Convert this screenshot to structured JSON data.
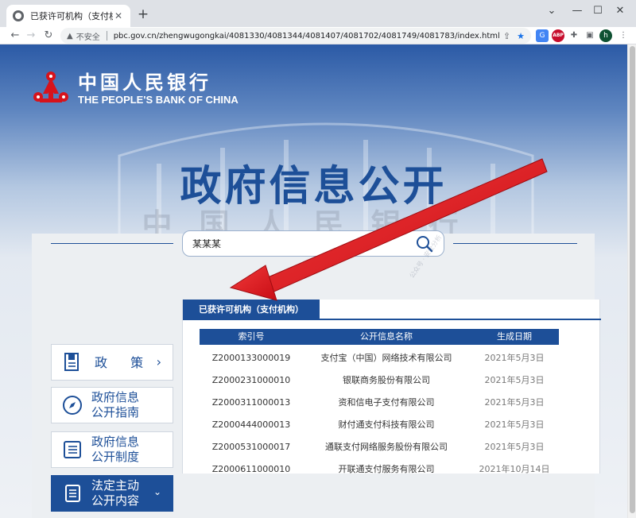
{
  "browser": {
    "tab_title": "已获许可机构（支付机构）",
    "tab_close": "✕",
    "new_tab": "+",
    "window_controls": [
      "⌄",
      "—",
      "☐",
      "✕"
    ],
    "security_label": "不安全",
    "url": "pbc.gov.cn/zhengwugongkai/4081330/4081344/4081407/4081702/4081749/4081783/index.html",
    "avatar_letter": "h",
    "abp_label": "ABP"
  },
  "header": {
    "logo_cn": "中国人民银行",
    "logo_en": "THE PEOPLE'S BANK OF CHINA",
    "hero_title": "政府信息公开",
    "building_inscription": "中国人民银行"
  },
  "search": {
    "value": "某某某"
  },
  "watermark": {
    "line1": "公众号 · ",
    "line2": "安全分析"
  },
  "sidebar": {
    "items": [
      {
        "label": "政 策",
        "chevron": "›"
      },
      {
        "label": "政府信息\n公开指南"
      },
      {
        "label": "政府信息\n公开制度"
      },
      {
        "label": "法定主动\n公开内容",
        "chevron": "⌄"
      }
    ]
  },
  "main": {
    "tab_label": "已获许可机构（支付机构）",
    "columns": [
      "索引号",
      "公开信息名称",
      "生成日期"
    ],
    "rows": [
      [
        "Z2000133000019",
        "支付宝（中国）网络技术有限公司",
        "2021年5月3日"
      ],
      [
        "Z2000231000010",
        "银联商务股份有限公司",
        "2021年5月3日"
      ],
      [
        "Z2000311000013",
        "资和信电子支付有限公司",
        "2021年5月3日"
      ],
      [
        "Z2000444000013",
        "财付通支付科技有限公司",
        "2021年5月3日"
      ],
      [
        "Z2000531000017",
        "通联支付网络服务股份有限公司",
        "2021年5月3日"
      ],
      [
        "Z2000611000010",
        "开联通支付服务有限公司",
        "2021年10月14日"
      ]
    ]
  },
  "colors": {
    "brand_blue": "#1d4f98",
    "emblem_red": "#d7131b",
    "annotation_arrow": "#e0141c"
  }
}
